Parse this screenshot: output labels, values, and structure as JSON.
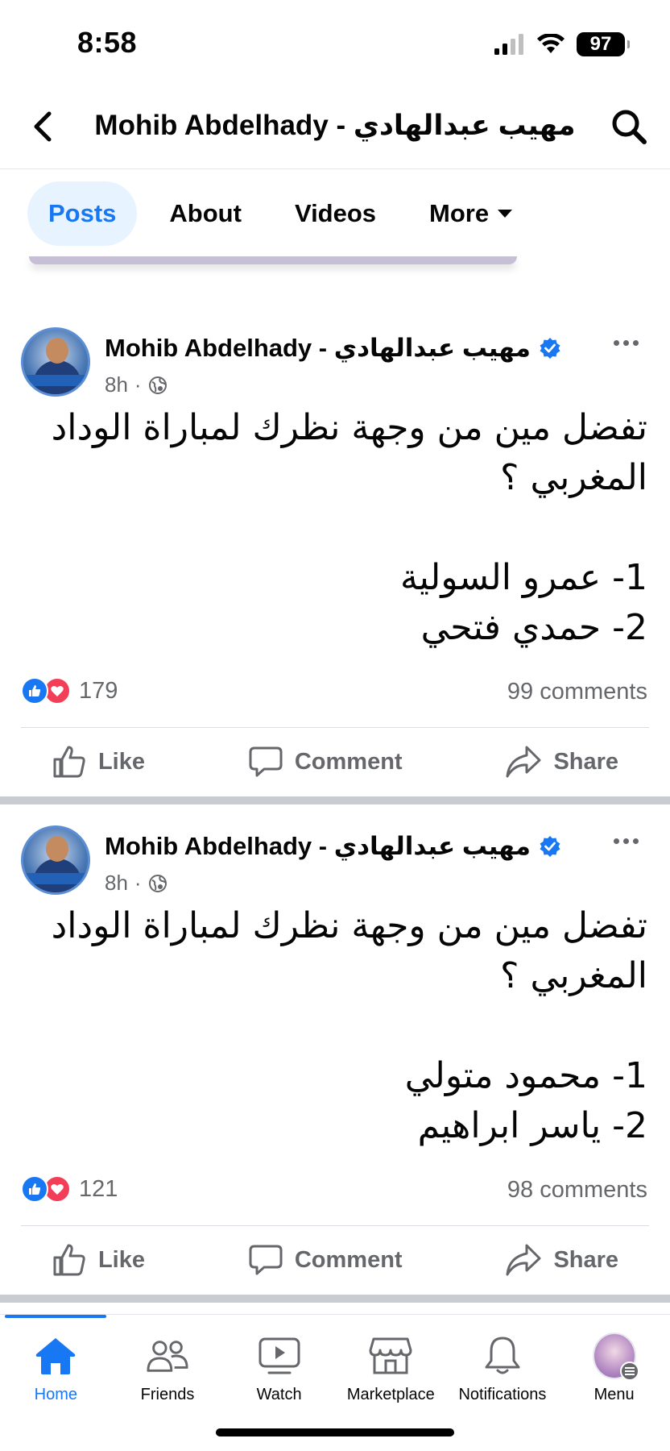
{
  "status_bar": {
    "time": "8:58",
    "battery": "97"
  },
  "header": {
    "title": "Mohib Abdelhady - مهيب عبدالهادي"
  },
  "tabs": [
    {
      "label": "Posts",
      "active": true
    },
    {
      "label": "About"
    },
    {
      "label": "Videos"
    },
    {
      "label": "More"
    }
  ],
  "posts": [
    {
      "author": "Mohib Abdelhady - مهيب عبدالهادي",
      "time": "8h",
      "lines": [
        "تفضل مين من وجهة نظرك لمباراة الوداد المغربي ؟",
        "",
        "1- عمرو السولية",
        "2- حمدي فتحي"
      ],
      "reaction_count": "179",
      "comments": "99 comments"
    },
    {
      "author": "Mohib Abdelhady - مهيب عبدالهادي",
      "time": "8h",
      "lines": [
        "تفضل مين من وجهة نظرك لمباراة الوداد المغربي ؟",
        "",
        "1- محمود متولي",
        "2- ياسر ابراهيم"
      ],
      "reaction_count": "121",
      "comments": "98 comments"
    }
  ],
  "actions": {
    "like": "Like",
    "comment": "Comment",
    "share": "Share"
  },
  "bottom_nav": [
    {
      "label": "Home",
      "icon": "home-icon",
      "active": true
    },
    {
      "label": "Friends",
      "icon": "friends-icon"
    },
    {
      "label": "Watch",
      "icon": "watch-icon"
    },
    {
      "label": "Marketplace",
      "icon": "marketplace-icon"
    },
    {
      "label": "Notifications",
      "icon": "bell-icon"
    },
    {
      "label": "Menu",
      "icon": "avatar"
    }
  ],
  "colors": {
    "brand": "#1877f2",
    "secondary_text": "#65676b",
    "love": "#f33e58"
  }
}
